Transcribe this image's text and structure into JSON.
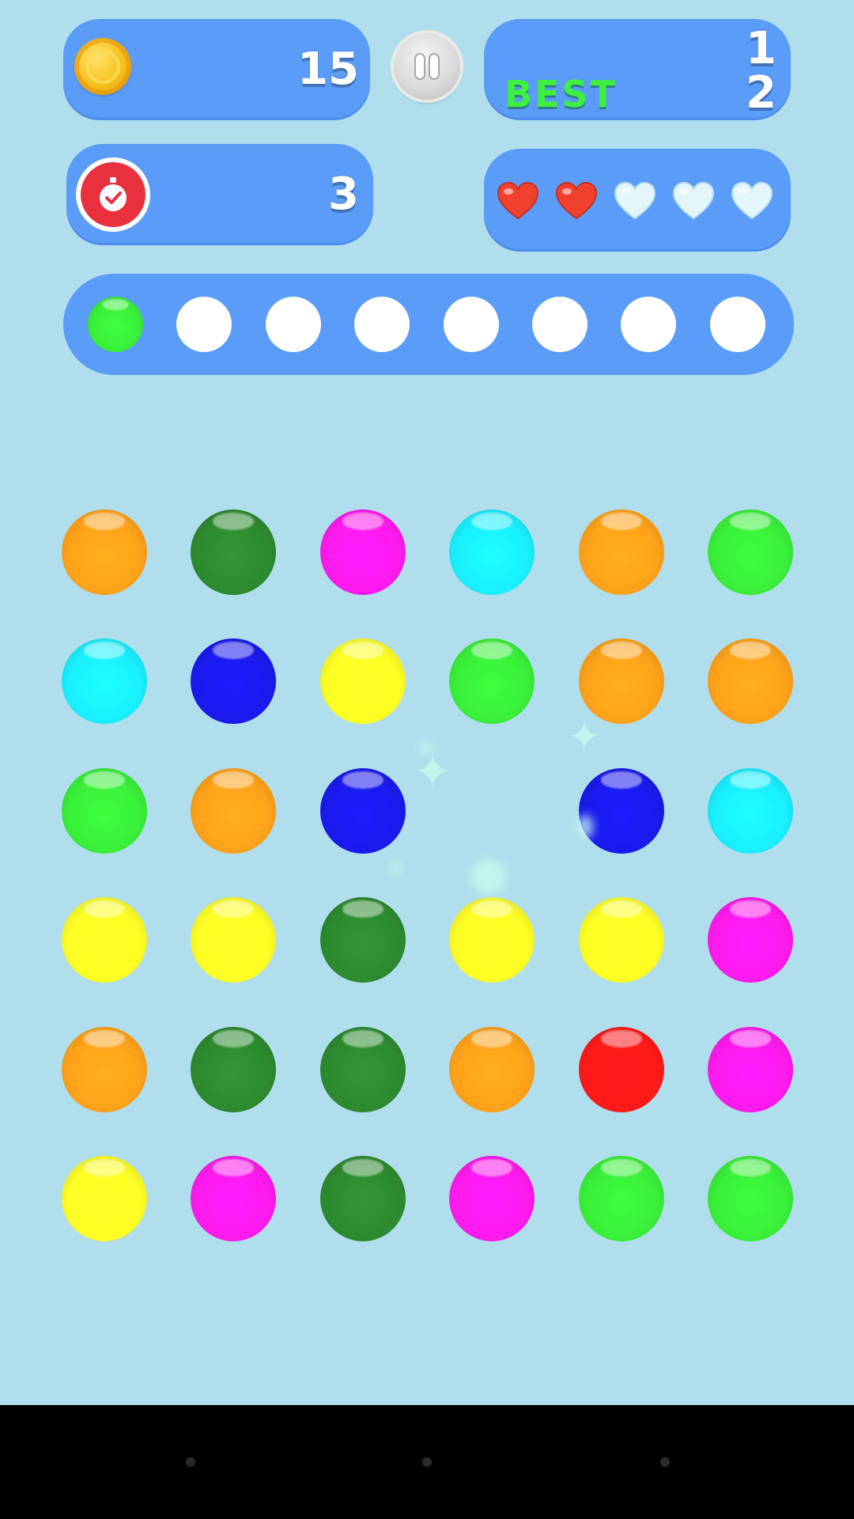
{
  "hud": {
    "coins": "15",
    "score": "1",
    "best_label": "BEST",
    "best": "2",
    "timer": "3",
    "lives_total": 5,
    "lives_remaining": 2
  },
  "sequence": {
    "slot_count": 8,
    "filled": [
      "green"
    ]
  },
  "board": {
    "rows": [
      [
        "orange",
        "darkgreen",
        "magenta",
        "cyan",
        "orange",
        "green"
      ],
      [
        "cyan",
        "blue",
        "yellow",
        "green",
        "orange",
        "orange"
      ],
      [
        "green",
        "orange",
        "blue",
        null,
        "blue",
        "cyan"
      ],
      [
        "yellow",
        "yellow",
        "darkgreen",
        "yellow",
        "yellow",
        "magenta"
      ],
      [
        "orange",
        "darkgreen",
        "darkgreen",
        "orange",
        "red",
        "magenta"
      ],
      [
        "yellow",
        "magenta",
        "darkgreen",
        "magenta",
        "green",
        "green"
      ]
    ]
  },
  "colors": {
    "panel": "#5a9cf8",
    "background": "#b0deec",
    "best_label": "#3ff03f",
    "orange": "#ffa31a",
    "darkgreen": "#2e8b30",
    "magenta": "#ff1aee",
    "cyan": "#1af0ff",
    "green": "#3af03a",
    "blue": "#1a1aee",
    "yellow": "#ffff26",
    "red": "#ff1a1a",
    "heart_full": "#f0412e",
    "heart_empty": "#e4f6fc"
  },
  "icons": {
    "coin": "coin-icon",
    "pause": "pause-icon",
    "timer": "stopwatch-icon",
    "life": "heart-icon"
  }
}
